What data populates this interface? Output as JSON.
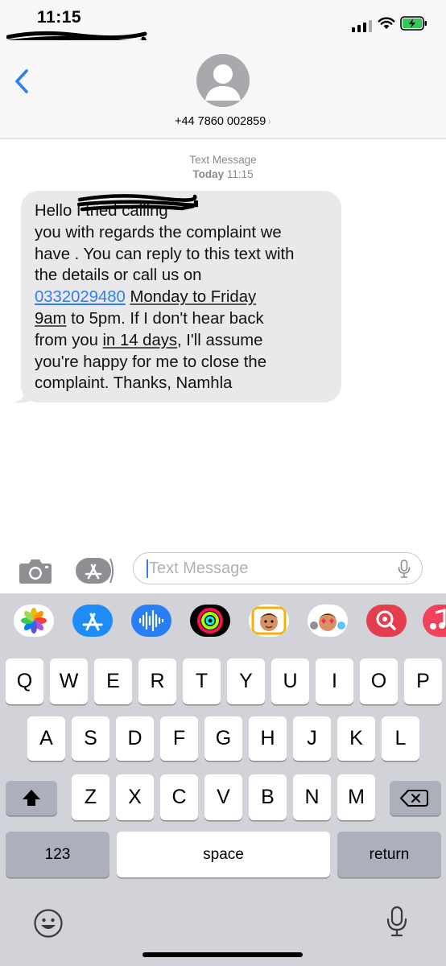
{
  "status_bar": {
    "time": "11:15"
  },
  "header": {
    "contact": "+44 7860 002859",
    "contact_chevron": "›",
    "back_icon": "chevron-left-icon"
  },
  "meta": {
    "label": "Text Message",
    "day": "Today",
    "time": "11:15"
  },
  "message": {
    "lines": [
      {
        "parts": [
          {
            "t": "Hello "
          },
          {
            "t": "                  "
          },
          {
            "t": "I tried calling"
          }
        ]
      },
      {
        "parts": [
          {
            "t": "you with regards the complaint we"
          }
        ]
      },
      {
        "parts": [
          {
            "t": "have . You can reply to this text with"
          }
        ]
      },
      {
        "parts": [
          {
            "t": "the details or call us on"
          }
        ]
      },
      {
        "parts": [
          {
            "t": "0332029480",
            "link": true
          },
          {
            "t": " "
          },
          {
            "t": "Monday to Friday",
            "ul": true
          }
        ]
      },
      {
        "parts": [
          {
            "t": "9am",
            "ul": true
          },
          {
            "t": " to 5pm. If I don't hear back"
          }
        ]
      },
      {
        "parts": [
          {
            "t": "from you "
          },
          {
            "t": "in 14 days",
            "ul": true
          },
          {
            "t": ", I'll assume"
          }
        ]
      },
      {
        "parts": [
          {
            "t": "you're happy for me to close the"
          }
        ]
      },
      {
        "parts": [
          {
            "t": "complaint. Thanks, Namhla"
          }
        ]
      }
    ]
  },
  "input": {
    "placeholder": "Text Message"
  },
  "app_strip": [
    {
      "name": "photos-app-icon",
      "bg": "#ffffff"
    },
    {
      "name": "appstore-app-icon",
      "bg": "#1e8cf5"
    },
    {
      "name": "audio-app-icon",
      "bg": "#2a7ef3"
    },
    {
      "name": "activity-app-icon",
      "bg": "#000000"
    },
    {
      "name": "memoji-app-icon",
      "bg": "#ffffff"
    },
    {
      "name": "memoji-stickers-app-icon",
      "bg": "#ffffff"
    },
    {
      "name": "images-search-app-icon",
      "bg": "#e43e4e"
    },
    {
      "name": "music-app-icon",
      "bg": "#f2415a"
    }
  ],
  "keyboard": {
    "row1": [
      "Q",
      "W",
      "E",
      "R",
      "T",
      "Y",
      "U",
      "I",
      "O",
      "P"
    ],
    "row2": [
      "A",
      "S",
      "D",
      "F",
      "G",
      "H",
      "J",
      "K",
      "L"
    ],
    "row3": [
      "Z",
      "X",
      "C",
      "V",
      "B",
      "N",
      "M"
    ],
    "numbers_label": "123",
    "space_label": "space",
    "return_label": "return"
  },
  "colors": {
    "accent": "#2f7ef6",
    "bubble": "#e9e9eb",
    "keyboard_bg": "#d1d3d9"
  }
}
